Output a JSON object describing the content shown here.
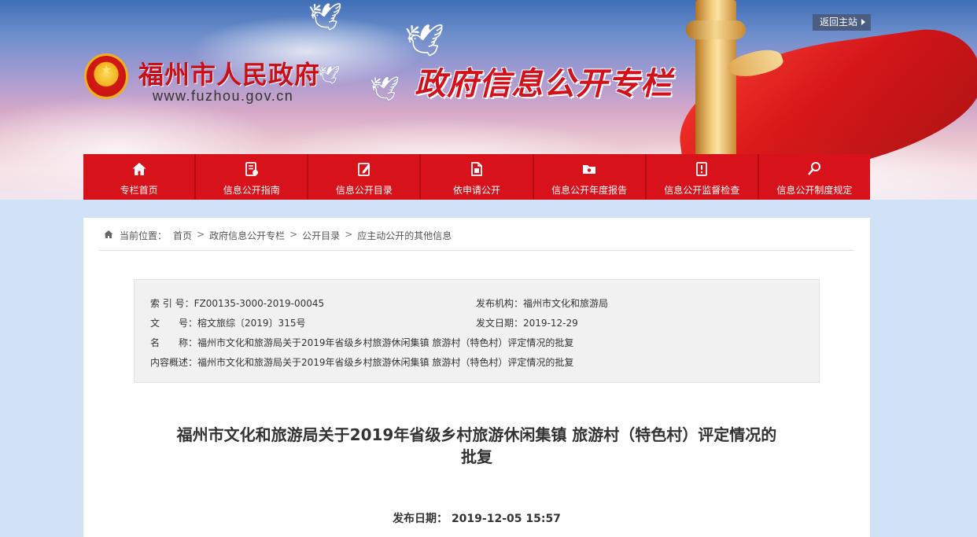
{
  "header": {
    "site_title": "福州市人民政府",
    "site_url": "www.fuzhou.gov.cn",
    "column_title": "政府信息公开专栏",
    "return_label": "返回主站",
    "brand_red": "#d8121a"
  },
  "nav": {
    "items": [
      {
        "label": "专栏首页",
        "icon": "home-icon"
      },
      {
        "label": "信息公开指南",
        "icon": "guide-document-icon"
      },
      {
        "label": "信息公开目录",
        "icon": "catalog-edit-icon"
      },
      {
        "label": "依申请公开",
        "icon": "file-request-icon"
      },
      {
        "label": "信息公开年度报告",
        "icon": "report-folder-icon"
      },
      {
        "label": "信息公开监督检查",
        "icon": "inspection-doc-icon"
      },
      {
        "label": "信息公开制度规定",
        "icon": "regulation-search-icon"
      }
    ]
  },
  "breadcrumb": {
    "prefix": "当前位置：",
    "items": [
      "首页",
      "政府信息公开专栏",
      "公开目录",
      "应主动公开的其他信息"
    ],
    "separator": ">"
  },
  "meta": {
    "index_key": "索 引 号：",
    "index_value": "FZ00135-3000-2019-00045",
    "publisher_key": "发布机构：",
    "publisher_value": "福州市文化和旅游局",
    "docno_key": "文　　号：",
    "docno_value": "榕文旅综〔2019〕315号",
    "issue_date_key": "发文日期：",
    "issue_date_value": "2019-12-29",
    "name_key": "名　　称：",
    "name_value": "福州市文化和旅游局关于2019年省级乡村旅游休闲集镇 旅游村（特色村）评定情况的批复",
    "summary_key": "内容概述：",
    "summary_value": "福州市文化和旅游局关于2019年省级乡村旅游休闲集镇 旅游村（特色村）评定情况的批复"
  },
  "article": {
    "title_line1": "福州市文化和旅游局关于2019年省级乡村旅游休闲集镇 旅游村（特色村）评定情况的",
    "title_line2": "批复",
    "pub_label": "发布日期：",
    "pub_value": "2019-12-05 15:57"
  }
}
